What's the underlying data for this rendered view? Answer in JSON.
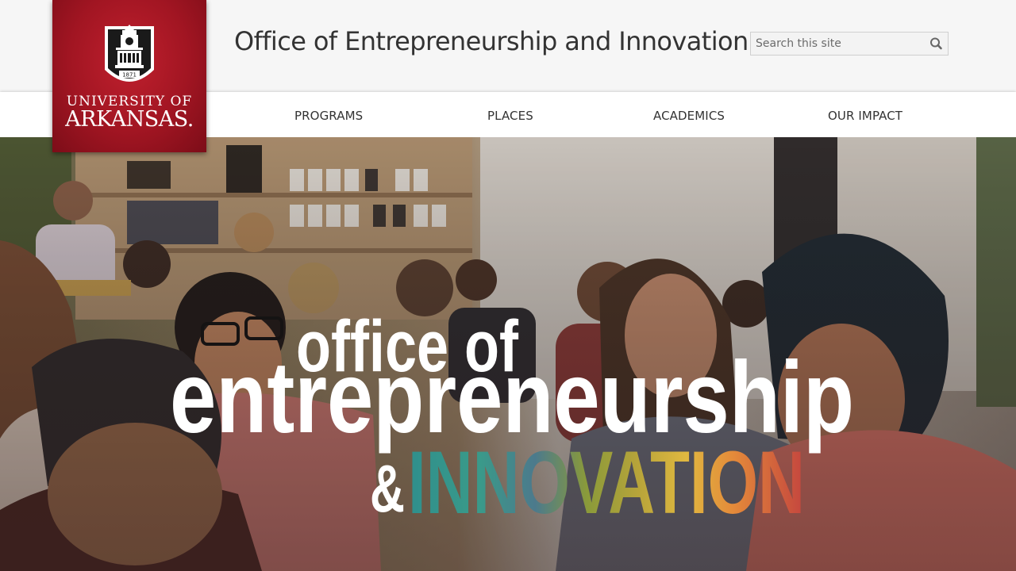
{
  "header": {
    "site_title": "Office of Entrepreneurship and Innovation"
  },
  "logo": {
    "line1": "UNIVERSITY OF",
    "line2": "ARKANSAS.",
    "seal_year": "1871"
  },
  "search": {
    "placeholder": "Search this site",
    "icon": "search-icon"
  },
  "nav": {
    "items": [
      {
        "label": "PROGRAMS"
      },
      {
        "label": "PLACES"
      },
      {
        "label": "ACADEMICS"
      },
      {
        "label": "OUR IMPACT"
      }
    ]
  },
  "hero": {
    "line1": "office of",
    "line2": "entrepreneurship",
    "amp": "&",
    "line3": "INNOVATION"
  },
  "colors": {
    "brand_red": "#9d2235",
    "hero_text": "#ffffff"
  }
}
